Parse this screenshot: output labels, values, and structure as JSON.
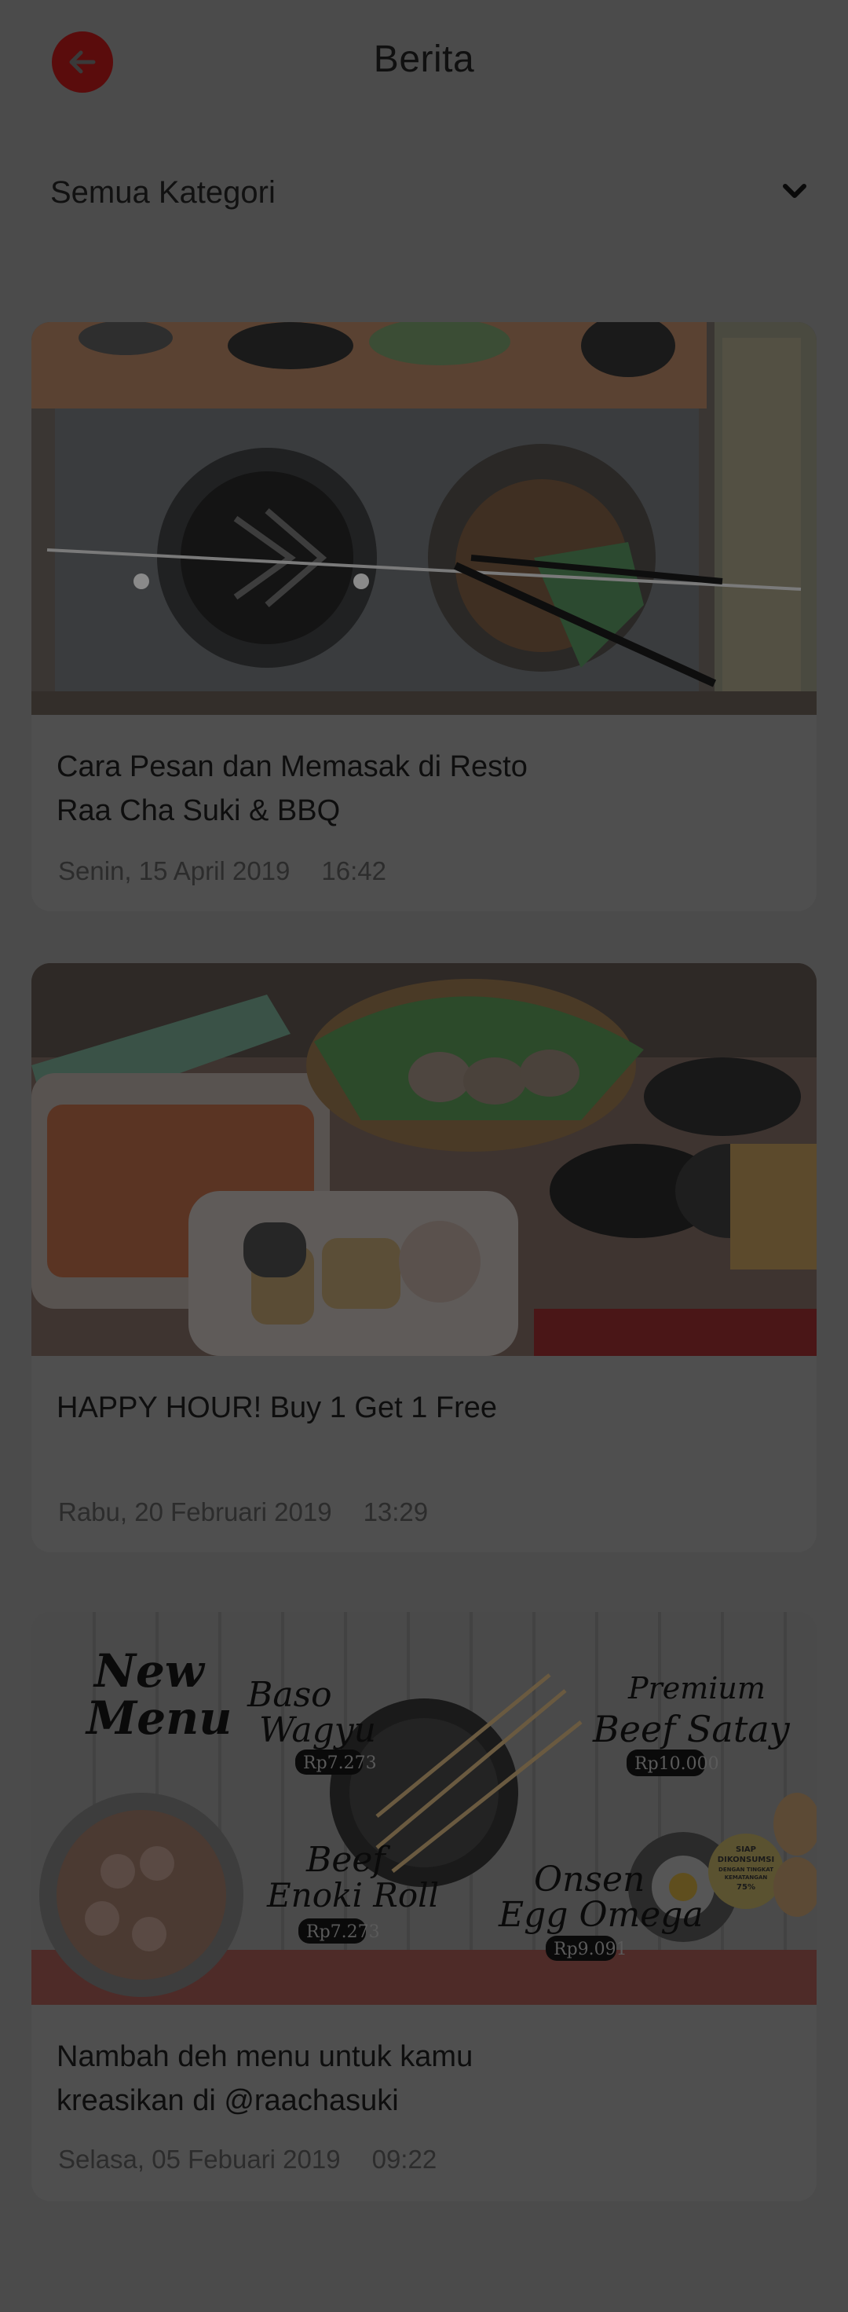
{
  "header": {
    "title": "Berita",
    "back_icon": "arrow-left-icon"
  },
  "filter": {
    "selected": "Semua Kategori",
    "icon": "chevron-down-icon"
  },
  "news": [
    {
      "title_line1": "Cara Pesan dan Memasak di Resto",
      "title_line2": "Raa Cha Suki & BBQ",
      "date": "Senin, 15 April 2019",
      "time": "16:42"
    },
    {
      "title_line1": "HAPPY HOUR! Buy 1 Get 1 Free",
      "title_line2": "",
      "date": "Rabu, 20 Februari 2019",
      "time": "13:29"
    },
    {
      "title_line1": "Nambah deh menu untuk kamu",
      "title_line2": "kreasikan di @raachasuki",
      "date": "Selasa, 05 Febuari 2019",
      "time": "09:22",
      "image_text": {
        "new_menu_1": "New",
        "new_menu_2": "Menu",
        "baso_1": "Baso",
        "baso_2": "Wagyu",
        "baso_price": "Rp7.273",
        "beef_1": "Beef",
        "beef_2": "Enoki Roll",
        "beef_price": "Rp7.273",
        "satay_1": "Premium",
        "satay_2": "Beef Satay",
        "satay_price": "Rp10.000",
        "onsen_1": "Onsen",
        "onsen_2": "Egg Omega",
        "onsen_price": "Rp9.091",
        "badge_1": "SIAP",
        "badge_2": "DIKONSUMSI",
        "badge_3": "DENGAN TINGKAT",
        "badge_4": "KEMATANGAN",
        "badge_5": "75%"
      }
    }
  ],
  "colors": {
    "overlay_bg": "#4b4b4b",
    "card_bg": "#4f4f4f",
    "accent": "#5a0c0c"
  }
}
